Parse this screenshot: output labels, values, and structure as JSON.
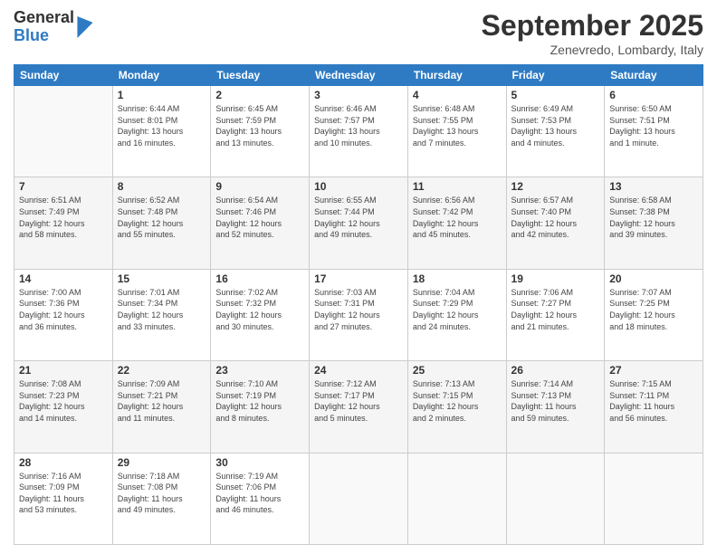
{
  "header": {
    "logo_general": "General",
    "logo_blue": "Blue",
    "month_title": "September 2025",
    "location": "Zenevredo, Lombardy, Italy"
  },
  "days_of_week": [
    "Sunday",
    "Monday",
    "Tuesday",
    "Wednesday",
    "Thursday",
    "Friday",
    "Saturday"
  ],
  "weeks": [
    [
      {
        "day": "",
        "info": ""
      },
      {
        "day": "1",
        "info": "Sunrise: 6:44 AM\nSunset: 8:01 PM\nDaylight: 13 hours\nand 16 minutes."
      },
      {
        "day": "2",
        "info": "Sunrise: 6:45 AM\nSunset: 7:59 PM\nDaylight: 13 hours\nand 13 minutes."
      },
      {
        "day": "3",
        "info": "Sunrise: 6:46 AM\nSunset: 7:57 PM\nDaylight: 13 hours\nand 10 minutes."
      },
      {
        "day": "4",
        "info": "Sunrise: 6:48 AM\nSunset: 7:55 PM\nDaylight: 13 hours\nand 7 minutes."
      },
      {
        "day": "5",
        "info": "Sunrise: 6:49 AM\nSunset: 7:53 PM\nDaylight: 13 hours\nand 4 minutes."
      },
      {
        "day": "6",
        "info": "Sunrise: 6:50 AM\nSunset: 7:51 PM\nDaylight: 13 hours\nand 1 minute."
      }
    ],
    [
      {
        "day": "7",
        "info": "Sunrise: 6:51 AM\nSunset: 7:49 PM\nDaylight: 12 hours\nand 58 minutes."
      },
      {
        "day": "8",
        "info": "Sunrise: 6:52 AM\nSunset: 7:48 PM\nDaylight: 12 hours\nand 55 minutes."
      },
      {
        "day": "9",
        "info": "Sunrise: 6:54 AM\nSunset: 7:46 PM\nDaylight: 12 hours\nand 52 minutes."
      },
      {
        "day": "10",
        "info": "Sunrise: 6:55 AM\nSunset: 7:44 PM\nDaylight: 12 hours\nand 49 minutes."
      },
      {
        "day": "11",
        "info": "Sunrise: 6:56 AM\nSunset: 7:42 PM\nDaylight: 12 hours\nand 45 minutes."
      },
      {
        "day": "12",
        "info": "Sunrise: 6:57 AM\nSunset: 7:40 PM\nDaylight: 12 hours\nand 42 minutes."
      },
      {
        "day": "13",
        "info": "Sunrise: 6:58 AM\nSunset: 7:38 PM\nDaylight: 12 hours\nand 39 minutes."
      }
    ],
    [
      {
        "day": "14",
        "info": "Sunrise: 7:00 AM\nSunset: 7:36 PM\nDaylight: 12 hours\nand 36 minutes."
      },
      {
        "day": "15",
        "info": "Sunrise: 7:01 AM\nSunset: 7:34 PM\nDaylight: 12 hours\nand 33 minutes."
      },
      {
        "day": "16",
        "info": "Sunrise: 7:02 AM\nSunset: 7:32 PM\nDaylight: 12 hours\nand 30 minutes."
      },
      {
        "day": "17",
        "info": "Sunrise: 7:03 AM\nSunset: 7:31 PM\nDaylight: 12 hours\nand 27 minutes."
      },
      {
        "day": "18",
        "info": "Sunrise: 7:04 AM\nSunset: 7:29 PM\nDaylight: 12 hours\nand 24 minutes."
      },
      {
        "day": "19",
        "info": "Sunrise: 7:06 AM\nSunset: 7:27 PM\nDaylight: 12 hours\nand 21 minutes."
      },
      {
        "day": "20",
        "info": "Sunrise: 7:07 AM\nSunset: 7:25 PM\nDaylight: 12 hours\nand 18 minutes."
      }
    ],
    [
      {
        "day": "21",
        "info": "Sunrise: 7:08 AM\nSunset: 7:23 PM\nDaylight: 12 hours\nand 14 minutes."
      },
      {
        "day": "22",
        "info": "Sunrise: 7:09 AM\nSunset: 7:21 PM\nDaylight: 12 hours\nand 11 minutes."
      },
      {
        "day": "23",
        "info": "Sunrise: 7:10 AM\nSunset: 7:19 PM\nDaylight: 12 hours\nand 8 minutes."
      },
      {
        "day": "24",
        "info": "Sunrise: 7:12 AM\nSunset: 7:17 PM\nDaylight: 12 hours\nand 5 minutes."
      },
      {
        "day": "25",
        "info": "Sunrise: 7:13 AM\nSunset: 7:15 PM\nDaylight: 12 hours\nand 2 minutes."
      },
      {
        "day": "26",
        "info": "Sunrise: 7:14 AM\nSunset: 7:13 PM\nDaylight: 11 hours\nand 59 minutes."
      },
      {
        "day": "27",
        "info": "Sunrise: 7:15 AM\nSunset: 7:11 PM\nDaylight: 11 hours\nand 56 minutes."
      }
    ],
    [
      {
        "day": "28",
        "info": "Sunrise: 7:16 AM\nSunset: 7:09 PM\nDaylight: 11 hours\nand 53 minutes."
      },
      {
        "day": "29",
        "info": "Sunrise: 7:18 AM\nSunset: 7:08 PM\nDaylight: 11 hours\nand 49 minutes."
      },
      {
        "day": "30",
        "info": "Sunrise: 7:19 AM\nSunset: 7:06 PM\nDaylight: 11 hours\nand 46 minutes."
      },
      {
        "day": "",
        "info": ""
      },
      {
        "day": "",
        "info": ""
      },
      {
        "day": "",
        "info": ""
      },
      {
        "day": "",
        "info": ""
      }
    ]
  ]
}
